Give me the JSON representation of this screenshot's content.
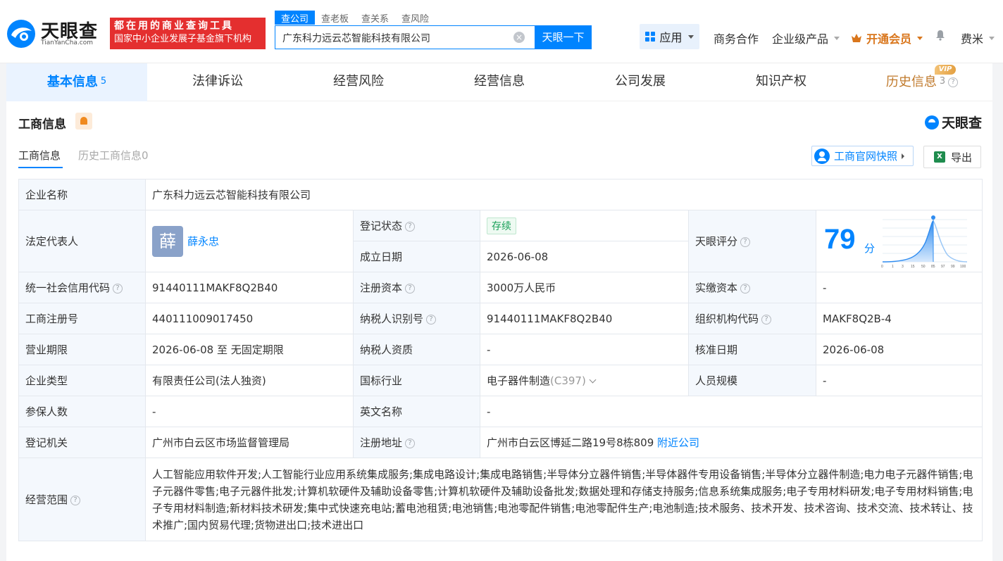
{
  "header": {
    "brand_name": "天眼查",
    "brand_url": "TianYanCha.com",
    "slogan_line1": "都在用的商业查询工具",
    "slogan_line2": "国家中小企业发展子基金旗下机构",
    "search_tabs": [
      "查公司",
      "查老板",
      "查关系",
      "查风险"
    ],
    "search_value": "广东科力远云芯智能科技有限公司",
    "search_button": "天眼一下",
    "nav": {
      "apps": "应用",
      "business": "商务合作",
      "enterprise": "企业级产品",
      "vip": "开通会员",
      "user": "费米"
    }
  },
  "tabs": [
    {
      "label": "基本信息",
      "count": "5"
    },
    {
      "label": "法律诉讼",
      "count": ""
    },
    {
      "label": "经营风险",
      "count": ""
    },
    {
      "label": "经营信息",
      "count": ""
    },
    {
      "label": "公司发展",
      "count": ""
    },
    {
      "label": "知识产权",
      "count": ""
    },
    {
      "label": "历史信息",
      "count": "3",
      "badge": "VIP"
    }
  ],
  "section": {
    "title": "工商信息",
    "brand": "天眼查",
    "subtab_active": "工商信息",
    "subtab_history": "历史工商信息0",
    "snapshot_button": "工商官网快照",
    "export_button": "导出"
  },
  "colors": {
    "accent": "#0084ff",
    "label_bg": "#f4f8fd",
    "status_green": "#18a058",
    "vip_orange": "#d9761c"
  },
  "info": {
    "company_name_label": "企业名称",
    "company_name": "广东科力远云芯智能科技有限公司",
    "legal_rep_label": "法定代表人",
    "legal_rep_avatar": "薛",
    "legal_rep": "薛永忠",
    "status_label": "登记状态",
    "status": "存续",
    "founded_label": "成立日期",
    "founded": "2026-06-08",
    "score_label": "天眼评分",
    "score": "79",
    "score_unit": "分",
    "score_ticks": [
      "0",
      "1",
      "3",
      "15",
      "50",
      "85",
      "97",
      "99",
      "100"
    ],
    "credit_code_label": "统一社会信用代码",
    "credit_code": "91440111MAKF8Q2B40",
    "reg_capital_label": "注册资本",
    "reg_capital": "3000万人民币",
    "paid_capital_label": "实缴资本",
    "paid_capital": "-",
    "reg_no_label": "工商注册号",
    "reg_no": "440111009017450",
    "taxpayer_id_label": "纳税人识别号",
    "taxpayer_id": "91440111MAKF8Q2B40",
    "org_code_label": "组织机构代码",
    "org_code": "MAKF8Q2B-4",
    "term_label": "营业期限",
    "term": "2026-06-08 至 无固定期限",
    "taxpayer_qual_label": "纳税人资质",
    "taxpayer_qual": "-",
    "approve_date_label": "核准日期",
    "approve_date": "2026-06-08",
    "type_label": "企业类型",
    "type": "有限责任公司(法人独资)",
    "industry_label": "国标行业",
    "industry": "电子器件制造",
    "industry_code": "(C397)",
    "staff_label": "人员规模",
    "staff": "-",
    "insured_label": "参保人数",
    "insured": "-",
    "english_label": "英文名称",
    "english": "-",
    "authority_label": "登记机关",
    "authority": "广州市白云区市场监督管理局",
    "address_label": "注册地址",
    "address": "广州市白云区博延二路19号8栋809",
    "nearby": "附近公司",
    "scope_label": "经营范围",
    "scope": "人工智能应用软件开发;人工智能行业应用系统集成服务;集成电路设计;集成电路销售;半导体分立器件销售;半导体器件专用设备销售;半导体分立器件制造;电力电子元器件销售;电子元器件零售;电子元器件批发;计算机软硬件及辅助设备零售;计算机软硬件及辅助设备批发;数据处理和存储支持服务;信息系统集成服务;电子专用材料研发;电子专用材料销售;电子专用材料制造;新材料技术研发;集中式快速充电站;蓄电池租赁;电池销售;电池零配件销售;电池零配件生产;电池制造;技术服务、技术开发、技术咨询、技术交流、技术转让、技术推广;国内贸易代理;货物进出口;技术进出口"
  }
}
